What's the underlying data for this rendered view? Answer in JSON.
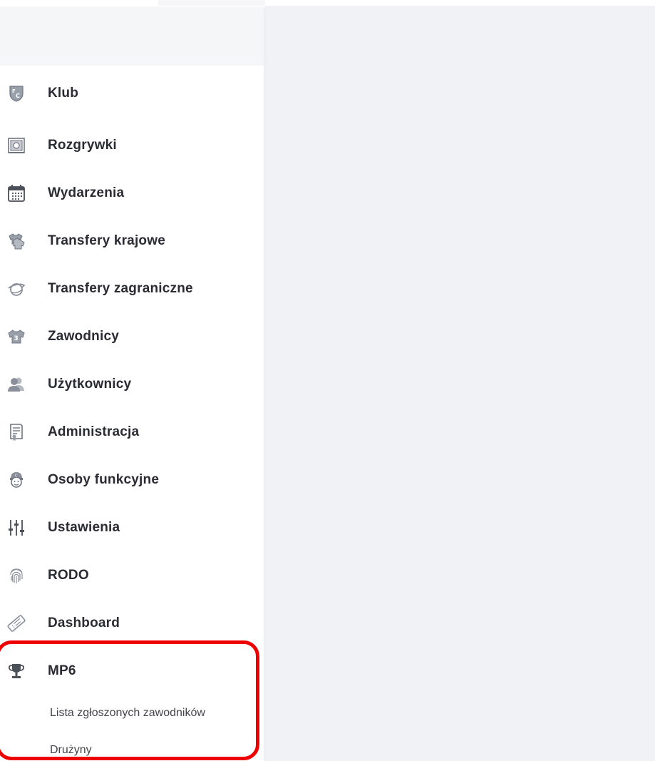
{
  "sidebar": {
    "items": [
      {
        "label": "Klub",
        "icon": "fc-shield-icon"
      },
      {
        "label": "Rozgrywki",
        "icon": "competition-board-icon"
      },
      {
        "label": "Wydarzenia",
        "icon": "calendar-icon"
      },
      {
        "label": "Transfery krajowe",
        "icon": "jersey-transfer-icon"
      },
      {
        "label": "Transfery zagraniczne",
        "icon": "globe-plane-icon"
      },
      {
        "label": "Zawodnicy",
        "icon": "jersey-number-icon"
      },
      {
        "label": "Użytkownicy",
        "icon": "users-icon"
      },
      {
        "label": "Administracja",
        "icon": "document-certificate-icon"
      },
      {
        "label": "Osoby funkcyjne",
        "icon": "referee-icon"
      },
      {
        "label": "Ustawienia",
        "icon": "sliders-icon"
      },
      {
        "label": "RODO",
        "icon": "fingerprint-icon"
      },
      {
        "label": "Dashboard",
        "icon": "ticket-icon"
      },
      {
        "label": "MP6",
        "icon": "trophy-icon"
      }
    ],
    "submenu": [
      {
        "label": "Lista zgłoszonych zawodników"
      },
      {
        "label": "Drużyny"
      }
    ]
  },
  "colors": {
    "highlight": "#ee0000",
    "text": "#2b2b33",
    "icon": "#8a8f99",
    "main_background": "#f1f2f6"
  }
}
